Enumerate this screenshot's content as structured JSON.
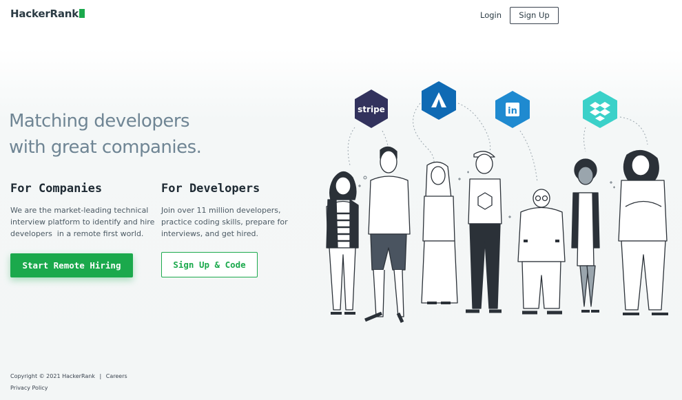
{
  "header": {
    "logo_text": "HackerRank",
    "login_label": "Login",
    "signup_label": "Sign Up"
  },
  "hero": {
    "title_line1": "Matching developers",
    "title_line2": "with great companies."
  },
  "companies": {
    "title": "For Companies",
    "desc_line1": "We are the market-leading technical",
    "desc_line2": "interview platform to identify and hire",
    "desc_line3": "developers  in a remote first world.",
    "button_label": "Start Remote Hiring"
  },
  "developers": {
    "title": "For Developers",
    "desc_line1": "Join over 11 million developers,",
    "desc_line2": "practice coding skills, prepare for",
    "desc_line3": "interviews, and get hired.",
    "button_label": "Sign Up & Code"
  },
  "illustration": {
    "stripe_text": "stripe",
    "linkedin_text": "in",
    "colors": {
      "stripe": "#32325d",
      "atlassian": "#0f6ab4",
      "linkedin": "#1f8ad0",
      "dropbox": "#3bd1c9",
      "brand_green": "#1ba94c"
    }
  },
  "footer": {
    "copyright": "Copyright © 2021 HackerRank",
    "separator": "|",
    "careers": "Careers",
    "privacy": "Privacy Policy"
  }
}
